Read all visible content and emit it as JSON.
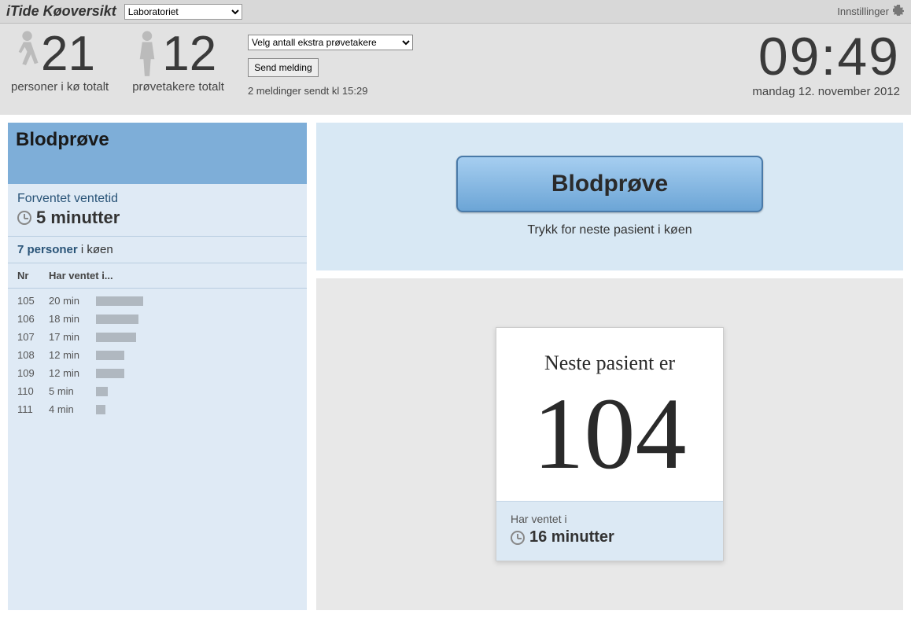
{
  "topbar": {
    "title": "iTide Køoversikt",
    "location_selected": "Laboratoriet",
    "settings_label": "Innstillinger"
  },
  "stats": {
    "queue_total": "21",
    "queue_total_label": "personer i kø totalt",
    "takers_total": "12",
    "takers_total_label": "prøvetakere totalt",
    "extra_select_label": "Velg antall ekstra prøvetakere",
    "send_btn_label": "Send melding",
    "msg_status": "2 meldinger sendt kl 15:29",
    "clock_time": "09:49",
    "clock_date": "mandag 12. november 2012"
  },
  "queue": {
    "title": "Blodprøve",
    "expected_wait_label": "Forventet ventetid",
    "expected_wait_value": "5 minutter",
    "count_bold": "7 personer",
    "count_rest": " i køen",
    "col_nr": "Nr",
    "col_wait": "Har ventet i...",
    "rows": [
      {
        "nr": "105",
        "time": "20 min",
        "bar": 60
      },
      {
        "nr": "106",
        "time": "18 min",
        "bar": 54
      },
      {
        "nr": "107",
        "time": "17 min",
        "bar": 51
      },
      {
        "nr": "108",
        "time": "12 min",
        "bar": 36
      },
      {
        "nr": "109",
        "time": "12 min",
        "bar": 36
      },
      {
        "nr": "110",
        "time": "5 min",
        "bar": 15
      },
      {
        "nr": "111",
        "time": "4 min",
        "bar": 12
      }
    ]
  },
  "call": {
    "button_label": "Blodprøve",
    "hint": "Trykk for neste pasient i køen"
  },
  "patient": {
    "next_label": "Neste pasient er",
    "number": "104",
    "wait_label": "Har ventet i",
    "wait_value": "16 minutter"
  }
}
